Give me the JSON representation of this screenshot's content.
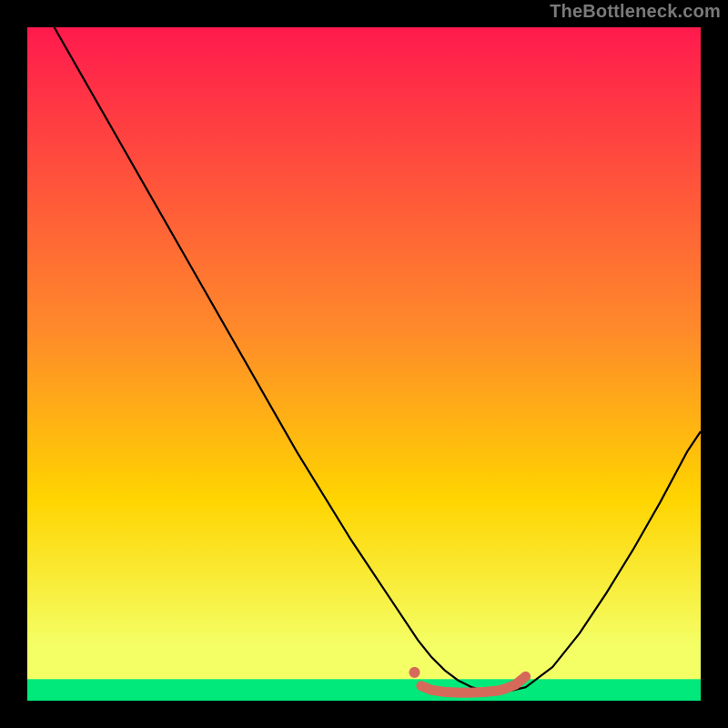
{
  "watermark": "TheBottleneck.com",
  "chart_data": {
    "type": "line",
    "title": "",
    "xlabel": "",
    "ylabel": "",
    "xlim": [
      0,
      100
    ],
    "ylim": [
      0,
      100
    ],
    "grid": false,
    "legend": false,
    "background_gradient": {
      "top": "#ff1a4d",
      "mid": "#ffd400",
      "band": "#f4ff66",
      "bottom": "#00e97a"
    },
    "series": [
      {
        "name": "bottleneck-curve",
        "type": "line",
        "color": "#000000",
        "x": [
          4,
          8,
          12,
          16,
          20,
          24,
          28,
          32,
          36,
          40,
          44,
          48,
          52,
          56,
          58,
          60,
          62,
          64,
          66,
          68,
          71,
          74,
          78,
          82,
          86,
          90,
          94,
          98,
          100
        ],
        "y": [
          100,
          93,
          86,
          79,
          72,
          65,
          58,
          51,
          44,
          37,
          30.5,
          24,
          18,
          12,
          9,
          6.5,
          4.5,
          3,
          2,
          1.5,
          1.3,
          2,
          5,
          10,
          16,
          22.5,
          29.5,
          37,
          40
        ]
      },
      {
        "name": "highlight-flat",
        "type": "line",
        "color": "#d66a5a",
        "stroke_width": 11,
        "linecap": "round",
        "x": [
          58.5,
          60,
          62,
          64,
          66,
          68,
          70,
          71,
          72.5,
          74
        ],
        "y": [
          2.2,
          1.6,
          1.3,
          1.2,
          1.2,
          1.3,
          1.5,
          1.8,
          2.4,
          3.6
        ]
      },
      {
        "name": "highlight-dot",
        "type": "scatter",
        "color": "#d66a5a",
        "size": 12,
        "x": [
          57.5
        ],
        "y": [
          4.2
        ]
      }
    ],
    "green_band_y": [
      0,
      3.2
    ]
  }
}
